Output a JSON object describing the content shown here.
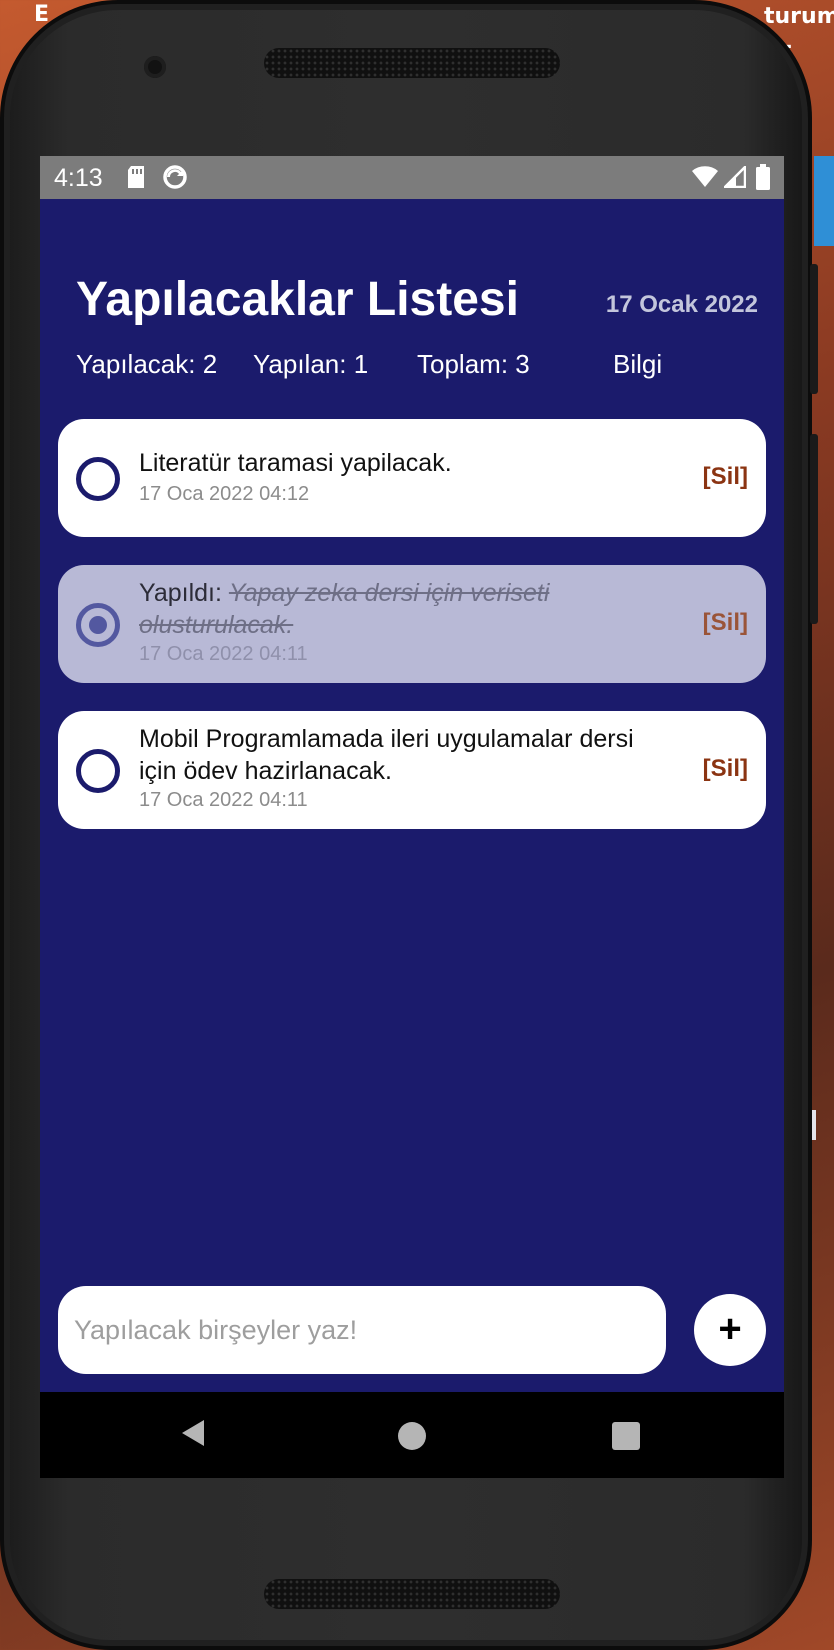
{
  "status_bar": {
    "time": "4:13",
    "icons": [
      "sd-card-icon",
      "sync-icon",
      "wifi-icon",
      "signal-icon",
      "battery-icon"
    ]
  },
  "header": {
    "title": "Yapılacaklar Listesi",
    "date": "17 Ocak 2022"
  },
  "stats": {
    "todo": "Yapılacak: 2",
    "done": "Yapılan: 1",
    "total": "Toplam: 3",
    "info": "Bilgi"
  },
  "tasks": [
    {
      "text": "Literatür taramasi yapilacak.",
      "timestamp": "17 Oca 2022 04:12",
      "done": false,
      "delete_label": "[Sil]"
    },
    {
      "prefix": "Yapıldı: ",
      "text": "Yapay zeka dersi için veriseti olusturulacak.",
      "timestamp": "17 Oca 2022 04:11",
      "done": true,
      "delete_label": "[Sil]"
    },
    {
      "text": "Mobil Programlamada ileri uygulamalar dersi için ödev hazirlanacak.",
      "timestamp": "17 Oca 2022 04:11",
      "done": false,
      "delete_label": "[Sil]"
    }
  ],
  "input": {
    "placeholder": "Yapılacak birşeyler yaz!",
    "value": ""
  },
  "add_button": {
    "label": "+"
  },
  "background_fragments": {
    "top_left": "E",
    "top_right": "turum",
    "top_right_2": "a-",
    "side": "Y"
  },
  "colors": {
    "app_background": "#1b1b6c",
    "card": "#ffffff",
    "card_done": "#b8b9d6",
    "delete_text": "#8b3412",
    "status_bar": "#7c7c7c"
  }
}
